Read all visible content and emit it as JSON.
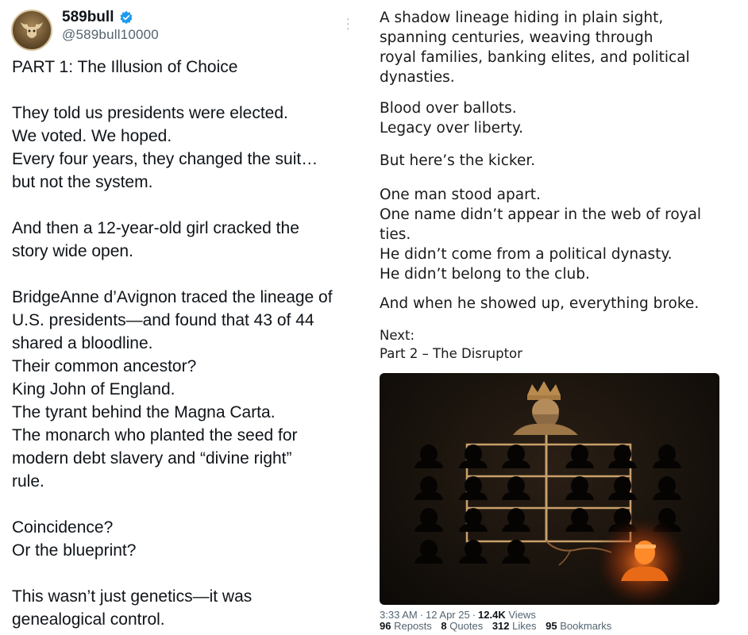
{
  "author": {
    "name": "589bull",
    "handle": "@589bull10000"
  },
  "left_text": {
    "title": "PART 1: The Illusion of Choice",
    "p1": [
      "They told us presidents were elected.",
      "We voted. We hoped.",
      "Every four years, they changed the suit…",
      "but not the system."
    ],
    "p2": [
      "And then a 12-year-old girl cracked the",
      "story wide open."
    ],
    "p3": [
      "BridgeAnne d’Avignon traced the lineage of",
      "U.S. presidents—and found that 43 of 44",
      "shared a bloodline.",
      "Their common ancestor?",
      "King John of England.",
      "The tyrant behind the Magna Carta.",
      "The monarch who planted the seed for",
      "modern debt slavery and “divine right”",
      "rule."
    ],
    "p4": [
      "Coincidence?",
      "Or the blueprint?"
    ],
    "p5": [
      "This wasn’t just genetics—it was",
      "genealogical control."
    ]
  },
  "right_text": {
    "p1": [
      "A shadow lineage hiding in plain sight,",
      "spanning centuries, weaving through",
      "royal families, banking elites, and political",
      "dynasties."
    ],
    "p2": [
      "Blood over ballots.",
      "Legacy over liberty."
    ],
    "p3": [
      "But here’s the kicker."
    ],
    "p4": [
      "One man stood apart.",
      "One name didn’t appear in the web of royal",
      "ties.",
      "He didn’t come from a political dynasty.",
      "He didn’t belong to the club."
    ],
    "p5": [
      "And when he showed up, everything broke."
    ],
    "next_label": "Next:",
    "next_title": "Part 2 – The Disruptor"
  },
  "meta": {
    "time": "3:33 AM",
    "date": "12 Apr 25",
    "views_count": "12.4K",
    "views_label": "Views",
    "reposts_count": "96",
    "reposts_label": "Reposts",
    "quotes_count": "8",
    "quotes_label": "Quotes",
    "likes_count": "312",
    "likes_label": "Likes",
    "bookmarks_count": "95",
    "bookmarks_label": "Bookmarks"
  },
  "colors": {
    "verified": "#1d9bf0",
    "muted": "#536471",
    "glow": "#ff6a1a",
    "gold": "#c9a06a"
  },
  "icons": [
    "verified-badge-icon",
    "more-options-icon"
  ]
}
